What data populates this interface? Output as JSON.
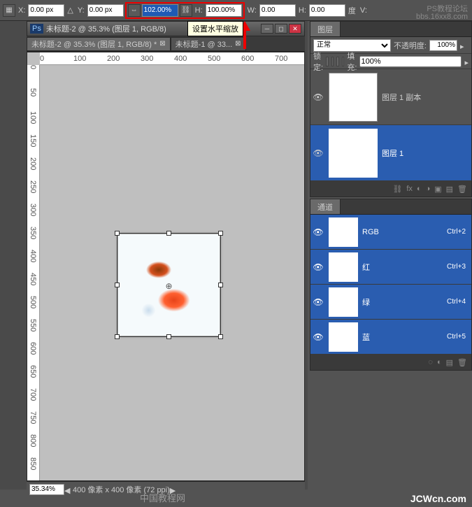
{
  "topbar": {
    "x_label": "X:",
    "x_value": "0.00 px",
    "y_label": "Y:",
    "y_value": "0.00 px",
    "w_label": "W:",
    "w_value": "102.00%",
    "h_label": "H:",
    "h_value": "100.00%",
    "w2_label": "W:",
    "w2_value": "0.00",
    "h2_label": "H:",
    "h2_value": "0.00",
    "deg_label": "度",
    "v_label": "V:"
  },
  "tooltip": "设置水平缩放",
  "doc": {
    "title": "未标题-2 @ 35.3% (图层 1, RGB/8)",
    "tab1": "未标题-2 @ 35.3% (图层 1, RGB/8) *",
    "tab2": "未标题-1 @ 33...",
    "ruler_marks_h": [
      "0",
      "100",
      "200",
      "300",
      "400",
      "500",
      "600",
      "700"
    ],
    "ruler_marks_v": [
      "0",
      "50",
      "100",
      "150",
      "200",
      "250",
      "300",
      "350",
      "400",
      "450",
      "500",
      "550",
      "600",
      "650",
      "700",
      "750",
      "800",
      "850"
    ]
  },
  "status": {
    "zoom": "35.34%",
    "info": "400 像素 x 400 像素 (72 ppi)"
  },
  "layers_panel": {
    "tab": "图层",
    "blend": "正常",
    "opacity_lbl": "不透明度:",
    "opacity": "100%",
    "lock_lbl": "锁定:",
    "fill_lbl": "填充:",
    "fill": "100%",
    "items": [
      {
        "name": "图层 1 副本",
        "selected": false
      },
      {
        "name": "图层 1",
        "selected": true
      }
    ]
  },
  "channels_panel": {
    "tab": "通道",
    "items": [
      {
        "name": "RGB",
        "key": "Ctrl+2",
        "color": true
      },
      {
        "name": "红",
        "key": "Ctrl+3",
        "color": false
      },
      {
        "name": "绿",
        "key": "Ctrl+4",
        "color": false
      },
      {
        "name": "蓝",
        "key": "Ctrl+5",
        "color": false
      }
    ]
  },
  "watermark": {
    "top": "PS教程论坛",
    "url": "bbs.16xx8.com",
    "brand": "JCWcn.com",
    "cn": "中国教程网"
  }
}
